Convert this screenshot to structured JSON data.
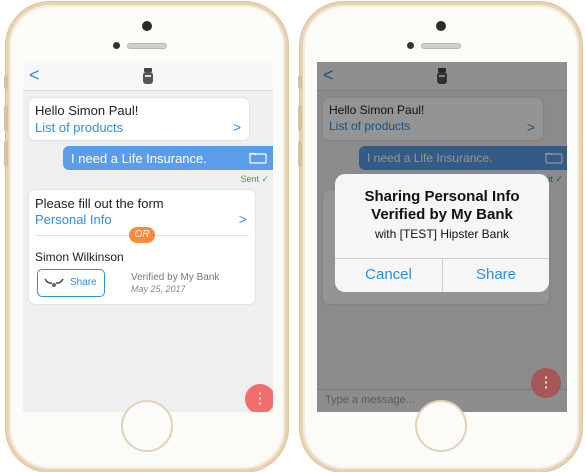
{
  "left": {
    "back": "<",
    "greeting": "Hello Simon Paul!",
    "products_link": "List of products",
    "chevron": ">",
    "user_message": "I need a Life Insurance.",
    "sent": "Sent",
    "form_prompt": "Please fill out the form",
    "form_link": "Personal Info",
    "or": "OR",
    "name": "Simon Wilkinson",
    "share": "Share",
    "verified": "Verified by My Bank",
    "date": "May 25, 2017",
    "fab": "⋮"
  },
  "right": {
    "back": "<",
    "greeting": "Hello Simon Paul!",
    "products_link": "List of products",
    "chevron": ">",
    "user_message": "I need a Life Insurance.",
    "sent": "Sent",
    "alert": {
      "title_line1": "Sharing Personal Info",
      "title_line2": "Verified by My Bank",
      "message": "with [TEST] Hipster Bank",
      "cancel": "Cancel",
      "share": "Share"
    },
    "composer_placeholder": "Type a message...",
    "fab": "⋮"
  },
  "colors": {
    "accent": "#2f8fd8",
    "bubble": "#5b9de8",
    "sent": "#3aa54b",
    "or_badge": "#ff8a3d",
    "fab": "#f26d6d",
    "phone_gold": "#e7d3b4"
  }
}
